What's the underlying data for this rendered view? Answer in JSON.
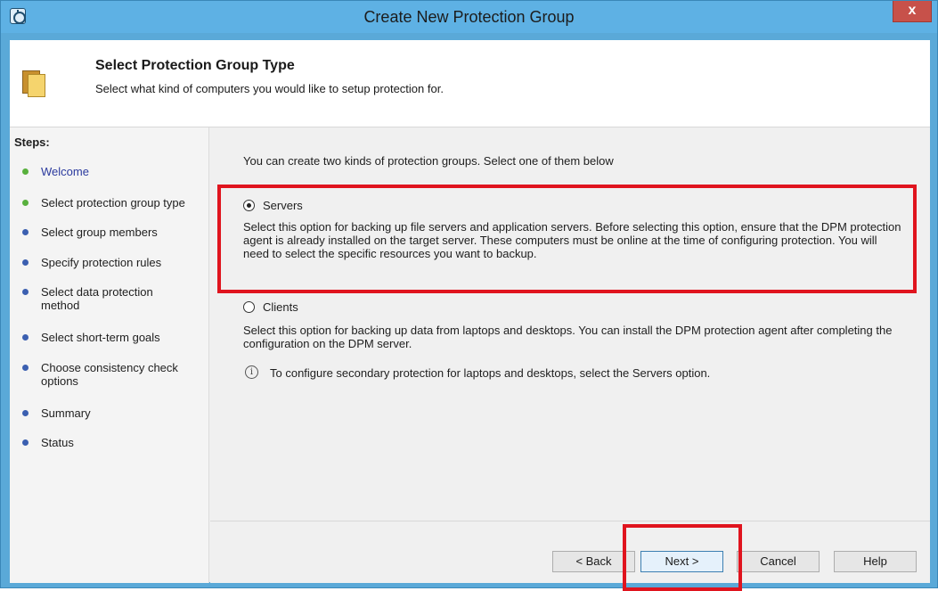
{
  "window": {
    "title": "Create New Protection Group",
    "close_label": "x"
  },
  "header": {
    "title": "Select Protection Group Type",
    "subtitle": "Select what kind of computers you would like to setup protection for."
  },
  "steps": {
    "title": "Steps:",
    "items": [
      {
        "label": "Welcome",
        "status": "green"
      },
      {
        "label": "Select protection group type",
        "status": "green"
      },
      {
        "label": "Select group members",
        "status": "blue"
      },
      {
        "label": "Specify protection rules",
        "status": "blue"
      },
      {
        "label": "Select data protection method",
        "status": "blue"
      },
      {
        "label": "Select short-term goals",
        "status": "blue"
      },
      {
        "label": "Choose consistency check options",
        "status": "blue"
      },
      {
        "label": "Summary",
        "status": "blue"
      },
      {
        "label": "Status",
        "status": "blue"
      }
    ]
  },
  "content": {
    "intro": "You can create two kinds of protection groups. Select one of them below",
    "servers": {
      "label": "Servers",
      "selected": true,
      "description": "Select this option for backing up file servers and application servers. Before selecting this option, ensure that the DPM protection agent is already installed on the target server. These computers must be online at the time of configuring protection. You will need to select the specific resources you want to backup."
    },
    "clients": {
      "label": "Clients",
      "selected": false,
      "description": "Select this option for backing up data from laptops and desktops. You can install the DPM protection agent after completing the configuration on the DPM server."
    },
    "info": "To configure secondary protection for laptops and desktops, select the Servers option."
  },
  "buttons": {
    "back": "< Back",
    "next": "Next >",
    "cancel": "Cancel",
    "help": "Help"
  },
  "colors": {
    "highlight": "#e0141e",
    "titlebar": "#5eb1e4",
    "step_done": "#58b03d",
    "step_pending": "#3b5fb0"
  }
}
